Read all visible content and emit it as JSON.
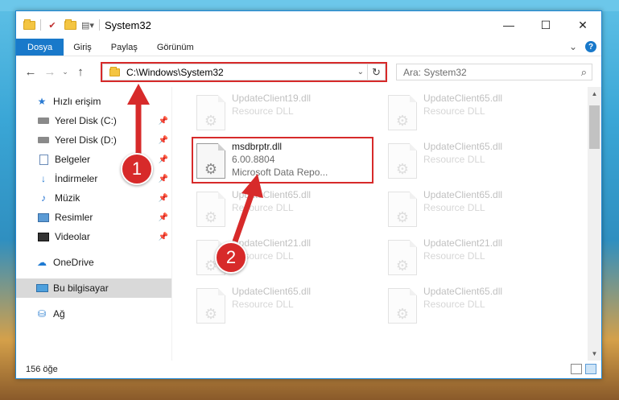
{
  "window": {
    "title": "System32",
    "controls": {
      "minimize": "—",
      "maximize": "☐",
      "close": "✕"
    }
  },
  "ribbon": {
    "tabs": [
      "Dosya",
      "Giriş",
      "Paylaş",
      "Görünüm"
    ],
    "expand": "⌄",
    "help": "?"
  },
  "nav": {
    "back": "←",
    "forward": "→",
    "recent": "⌄",
    "up": "↑",
    "address_path": "C:\\Windows\\System32",
    "address_dropdown": "⌄",
    "refresh": "↻",
    "search_placeholder": "Ara: System32",
    "search_icon": "⌕"
  },
  "sidebar": {
    "items": [
      {
        "label": "Hızlı erişim",
        "icon": "star-icon"
      },
      {
        "label": "Yerel Disk (C:)",
        "icon": "drive-icon",
        "pinned": true
      },
      {
        "label": "Yerel Disk (D:)",
        "icon": "drive-icon",
        "pinned": true
      },
      {
        "label": "Belgeler",
        "icon": "documents-icon",
        "pinned": true
      },
      {
        "label": "İndirmeler",
        "icon": "download-icon",
        "pinned": true
      },
      {
        "label": "Müzik",
        "icon": "music-icon",
        "pinned": true
      },
      {
        "label": "Resimler",
        "icon": "pictures-icon",
        "pinned": true
      },
      {
        "label": "Videolar",
        "icon": "videos-icon",
        "pinned": true
      },
      {
        "label": "OneDrive",
        "icon": "onedrive-icon"
      },
      {
        "label": "Bu bilgisayar",
        "icon": "computer-icon",
        "selected": true
      },
      {
        "label": "Ağ",
        "icon": "network-icon"
      }
    ],
    "pin_glyph": "📌"
  },
  "files": {
    "left_column": [
      {
        "name": "UpdateClient19.dll",
        "subtitle": "Resource DLL"
      },
      {
        "name": "msdbrptr.dll",
        "subtitle": "6.00.8804",
        "subtitle2": "Microsoft Data Repo...",
        "highlighted": true
      },
      {
        "name": "UpdateClient65.dll",
        "subtitle": "Resource DLL"
      },
      {
        "name": "UpdateClient21.dll",
        "subtitle": "Resource DLL"
      },
      {
        "name": "UpdateClient65.dll",
        "subtitle": "Resource DLL"
      }
    ],
    "right_column": [
      {
        "name": "UpdateClient65.dll",
        "subtitle": "Resource DLL"
      },
      {
        "name": "UpdateClient65.dll",
        "subtitle": "Resource DLL"
      },
      {
        "name": "UpdateClient65.dll",
        "subtitle": "Resource DLL"
      },
      {
        "name": "UpdateClient21.dll",
        "subtitle": "Resource DLL"
      },
      {
        "name": "UpdateClient65.dll",
        "subtitle": "Resource DLL"
      }
    ]
  },
  "status": {
    "item_count": "156 öğe"
  },
  "annotations": {
    "step1": "1",
    "step2": "2",
    "accent": "#d72a2a"
  }
}
